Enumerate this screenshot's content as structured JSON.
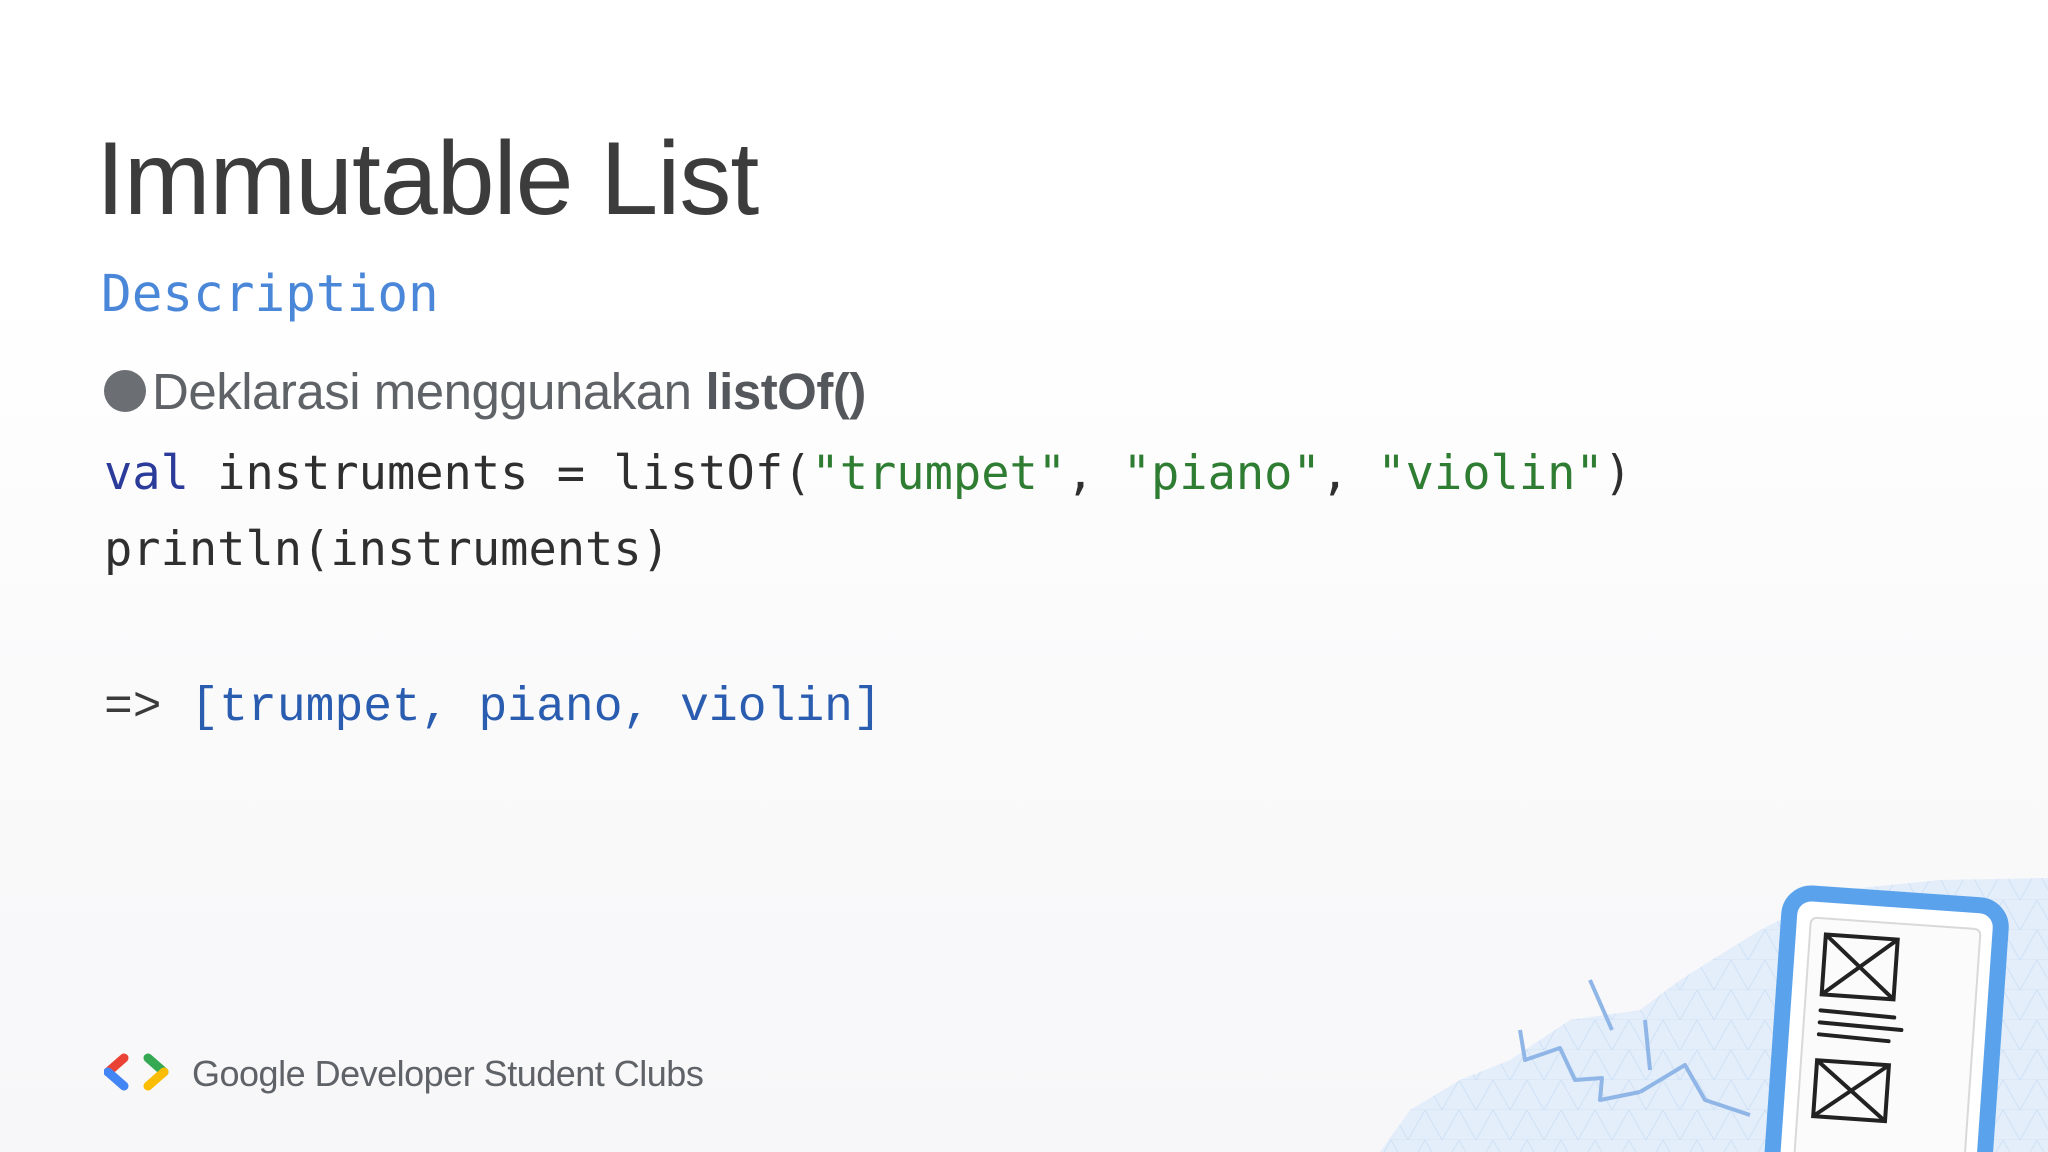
{
  "slide": {
    "title": "Immutable List",
    "subtitle": "Description",
    "bullet": {
      "text": "Deklarasi menggunakan",
      "code": "listOf()"
    },
    "code_lines": {
      "line1": {
        "keyword": "val",
        "declaration": " instruments = listOf(",
        "str1": "\"trumpet\"",
        "sep1": ", ",
        "str2": "\"piano\"",
        "sep2": ", ",
        "str3": "\"violin\"",
        "close": ")"
      },
      "line2": "println(instruments)"
    },
    "output": {
      "arrow": "=> ",
      "value": "[trumpet, piano, violin]"
    },
    "footer": {
      "brand": "Google Developer Student Clubs"
    }
  },
  "colors": {
    "title": "#3c3c3c",
    "subtitle": "#4a87d8",
    "keyword": "#2b3b9a",
    "string": "#2e7d32",
    "output": "#2a5db0",
    "logo_red": "#ea4335",
    "logo_blue": "#4285f4",
    "logo_green": "#34a853",
    "logo_yellow": "#fbbc04"
  },
  "icons": {
    "logo": "gdsc-brackets-logo",
    "illustration": "phone-wireframe-illustration"
  }
}
